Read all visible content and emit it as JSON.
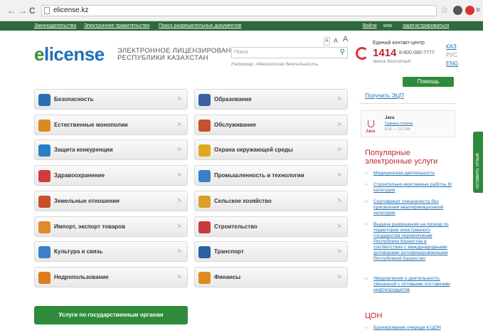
{
  "browser": {
    "url": "elicense.kz"
  },
  "topnav": {
    "links": [
      "Законодательство",
      "Электронное правительство",
      "Поиск разрешительных документов"
    ],
    "login": "Войти",
    "or": "или",
    "register": "зарегистрироваться"
  },
  "header": {
    "logo_e": "e",
    "logo_rest": "license",
    "subtitle_1": "ЭЛЕКТРОННОЕ ЛИЦЕНЗИРОВАНИЕ",
    "subtitle_2": "РЕСПУБЛИКИ КАЗАХСТАН",
    "search_placeholder": "Поиск",
    "search_hint": "Например: Адвокатская деятельность",
    "font_sizes": [
      "A",
      "A",
      "A"
    ]
  },
  "contact": {
    "title": "Единый контакт-центр",
    "short": "1414",
    "phone": "8-800-080-7777",
    "note": "звонок бесплатный"
  },
  "languages": [
    "КАЗ",
    "РУС",
    "ENG"
  ],
  "help": "Помощь",
  "categories_left": [
    {
      "label": "Безопасность",
      "color": "#2a6fb5"
    },
    {
      "label": "Естественные монополии",
      "color": "#d98a1f"
    },
    {
      "label": "Защита конкуренции",
      "color": "#2a7fc9"
    },
    {
      "label": "Здравоохранение",
      "color": "#d23b3b"
    },
    {
      "label": "Земельные отношения",
      "color": "#c8502a"
    },
    {
      "label": "Импорт, экспорт товаров",
      "color": "#e08a2a"
    },
    {
      "label": "Культура и связь",
      "color": "#3a7fc9"
    },
    {
      "label": "Недропользование",
      "color": "#e07a1f"
    }
  ],
  "categories_right": [
    {
      "label": "Образование",
      "color": "#3a5fa5"
    },
    {
      "label": "Обслуживание",
      "color": "#c8502a"
    },
    {
      "label": "Охрана окружающей среды",
      "color": "#e0a81f"
    },
    {
      "label": "Промышленность и технологии",
      "color": "#3a7fc9"
    },
    {
      "label": "Сельское хозяйство",
      "color": "#d9a02a"
    },
    {
      "label": "Строительство",
      "color": "#c83a3a"
    },
    {
      "label": "Транспорт",
      "color": "#2a5fa5"
    },
    {
      "label": "Финансы",
      "color": "#e08a1f"
    }
  ],
  "chevron": ">",
  "gov_services": "Услуги по государственным органам",
  "sidebar": {
    "ecp_link": "Получить ЭЦП",
    "java": {
      "label": "Java",
      "title": "Java",
      "link": "Скачать плагин",
      "meta": "EXE — 15.2 Mb"
    },
    "popular_title": "Популярные электронные услуги",
    "services": [
      "Медицинская деятельность",
      "Строительно-монтажные работы III категория",
      "Сертификат специалиста без присвоения квалификационной категории",
      "Выдача разрешения на проезд по территории иностранного государства перевозчикам Республики Казахстан в соответствии с международными договорами ратифицированными Республикой Казахстан",
      "Уведомление о деятельности, связанной с оптовыми поставками нефтепродуктов"
    ],
    "tson_title": "ЦОН",
    "tson_item": "Бронирование очереди в ЦОН"
  },
  "feedback": "оставить отзыв"
}
